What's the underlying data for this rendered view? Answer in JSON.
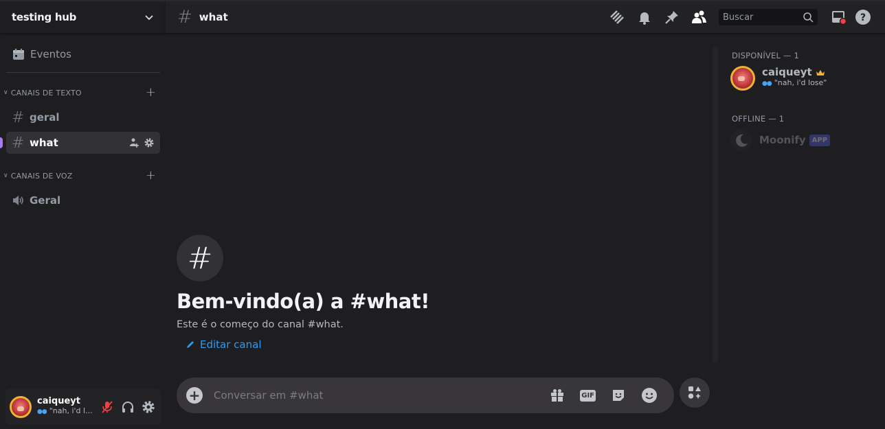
{
  "server": {
    "name": "testing hub"
  },
  "sidebar": {
    "events_label": "Eventos",
    "categories": [
      {
        "label": "CANAIS DE TEXTO",
        "channels": [
          {
            "name": "geral",
            "type": "text",
            "active": false
          },
          {
            "name": "what",
            "type": "text",
            "active": true
          }
        ]
      },
      {
        "label": "CANAIS DE VOZ",
        "channels": [
          {
            "name": "Geral",
            "type": "voice",
            "active": false
          }
        ]
      }
    ]
  },
  "user": {
    "name": "caiqueyt",
    "status": "\"nah, i'd l..."
  },
  "header": {
    "channel": "what",
    "search_placeholder": "Buscar",
    "icons": [
      "threads-icon",
      "bell-icon",
      "pin-icon",
      "members-icon",
      "inbox-icon",
      "help-icon"
    ]
  },
  "welcome": {
    "title": "Bem-vindo(a) a #what!",
    "subtitle": "Este é o começo do canal #what.",
    "edit_label": "Editar canal"
  },
  "composer": {
    "placeholder": "Conversar em #what",
    "gif_label": "GIF"
  },
  "members": {
    "groups": [
      {
        "label": "DISPONÍVEL — 1",
        "members": [
          {
            "name": "caiqueyt",
            "status": "\"nah, i'd lose\"",
            "owner": true
          }
        ]
      },
      {
        "label": "OFFLINE — 1",
        "members": [
          {
            "name": "Moonify",
            "badge": "APP"
          }
        ]
      }
    ]
  },
  "colors": {
    "accent": "#a27ef5",
    "link": "#2b9cf2",
    "mute_red": "#f23f43",
    "owner_crown": "#f0b232"
  }
}
